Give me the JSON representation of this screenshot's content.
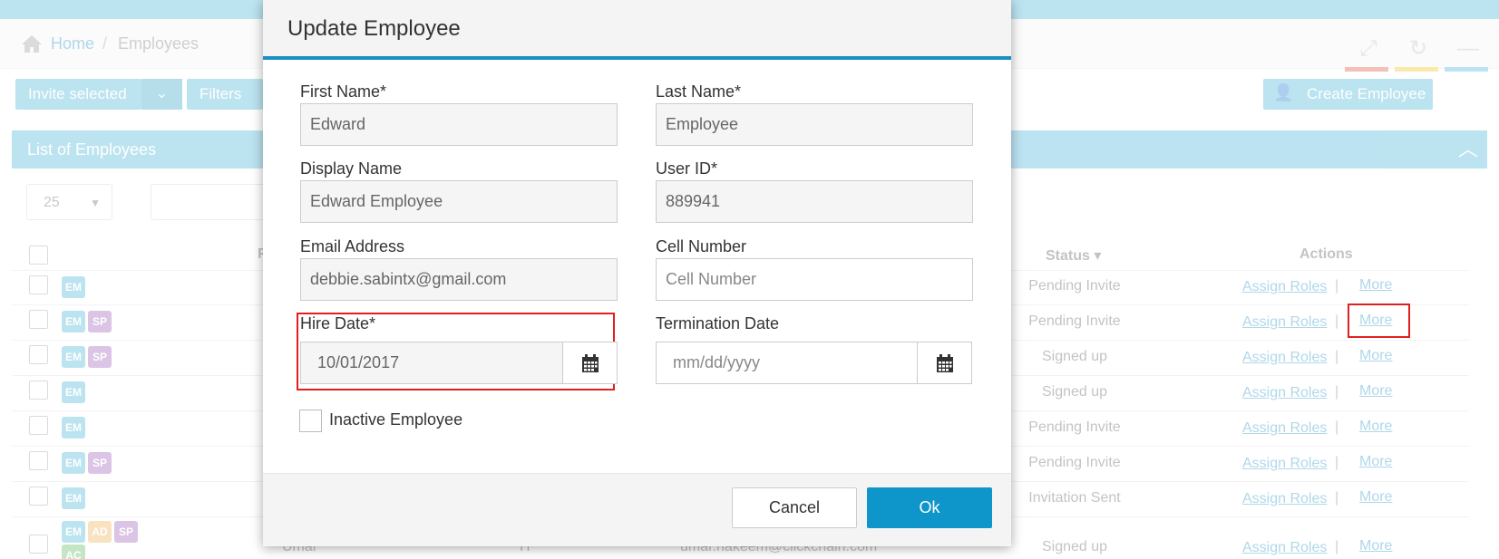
{
  "breadcrumb": {
    "home": "Home",
    "separator": "/",
    "current": "Employees"
  },
  "toolbar": {
    "invite_selected": "Invite selected",
    "filters": "Filters",
    "create_employee": "Create Employee"
  },
  "panel": {
    "title": "List of Employees",
    "page_size": "25"
  },
  "table": {
    "headers": {
      "status": "Status",
      "actions": "Actions",
      "partial_f": "F"
    },
    "rows": [
      {
        "badges": [
          "EM"
        ],
        "status": "Pending Invite",
        "assign": "Assign Roles",
        "more": "More"
      },
      {
        "badges": [
          "EM",
          "SP"
        ],
        "status": "Pending Invite",
        "assign": "Assign Roles",
        "more": "More"
      },
      {
        "badges": [
          "EM",
          "SP"
        ],
        "status": "Signed up",
        "assign": "Assign Roles",
        "more": "More"
      },
      {
        "badges": [
          "EM"
        ],
        "status": "Signed up",
        "assign": "Assign Roles",
        "more": "More"
      },
      {
        "badges": [
          "EM"
        ],
        "status": "Pending Invite",
        "assign": "Assign Roles",
        "more": "More"
      },
      {
        "badges": [
          "EM",
          "SP"
        ],
        "status": "Pending Invite",
        "assign": "Assign Roles",
        "more": "More"
      },
      {
        "badges": [
          "EM"
        ],
        "status": "Invitation Sent",
        "assign": "Assign Roles",
        "more": "More"
      },
      {
        "badges": [
          "EM",
          "AD",
          "SP",
          "AC"
        ],
        "first": "Umar",
        "last": "H",
        "email": "umar.hakeem@clickchain.com",
        "status": "Signed up",
        "assign": "Assign Roles",
        "more": "More"
      }
    ],
    "pipe": "|"
  },
  "modal": {
    "title": "Update Employee",
    "first_name": {
      "label": "First Name*",
      "value": "Edward"
    },
    "last_name": {
      "label": "Last Name*",
      "value": "Employee"
    },
    "display_name": {
      "label": "Display Name",
      "value": "Edward Employee"
    },
    "user_id": {
      "label": "User ID*",
      "value": "889941"
    },
    "email": {
      "label": "Email Address",
      "value": "debbie.sabintx@gmail.com"
    },
    "cell": {
      "label": "Cell Number",
      "placeholder": "Cell Number"
    },
    "hire_date": {
      "label": "Hire Date*",
      "value": "10/01/2017"
    },
    "termination_date": {
      "label": "Termination Date",
      "placeholder": "mm/dd/yyyy"
    },
    "inactive_label": "Inactive Employee",
    "cancel": "Cancel",
    "ok": "Ok"
  },
  "colors": {
    "accent": "#1a8fc2",
    "ok_button": "#0e95c9",
    "highlight": "#e02020"
  }
}
